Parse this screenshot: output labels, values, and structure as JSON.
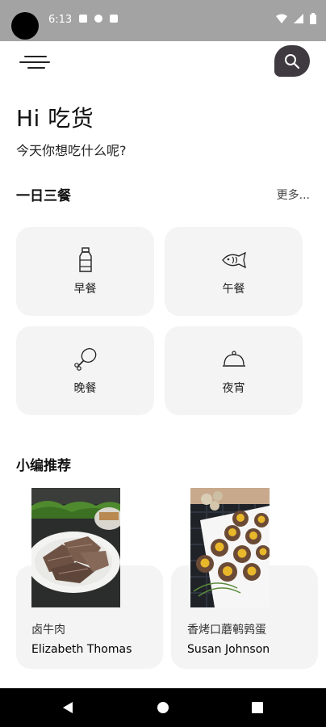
{
  "status": {
    "time": "6:13"
  },
  "greeting": {
    "title": "Hi 吃货",
    "subtitle": "今天你想吃什么呢?"
  },
  "meals": {
    "title": "一日三餐",
    "more": "更多...",
    "items": [
      {
        "label": "早餐",
        "icon": "milk-bottle-icon"
      },
      {
        "label": "午餐",
        "icon": "fish-icon"
      },
      {
        "label": "晚餐",
        "icon": "chicken-leg-icon"
      },
      {
        "label": "夜宵",
        "icon": "cloche-icon"
      }
    ]
  },
  "recommend": {
    "title": "小编推荐",
    "items": [
      {
        "name": "卤牛肉",
        "author": "Elizabeth Thomas"
      },
      {
        "name": "香烤口蘑鹌鹑蛋",
        "author": "Susan Johnson"
      }
    ]
  },
  "colors": {
    "accent": "#3f3a40",
    "card": "#f4f4f4",
    "statusbar": "#a3a3a3"
  }
}
